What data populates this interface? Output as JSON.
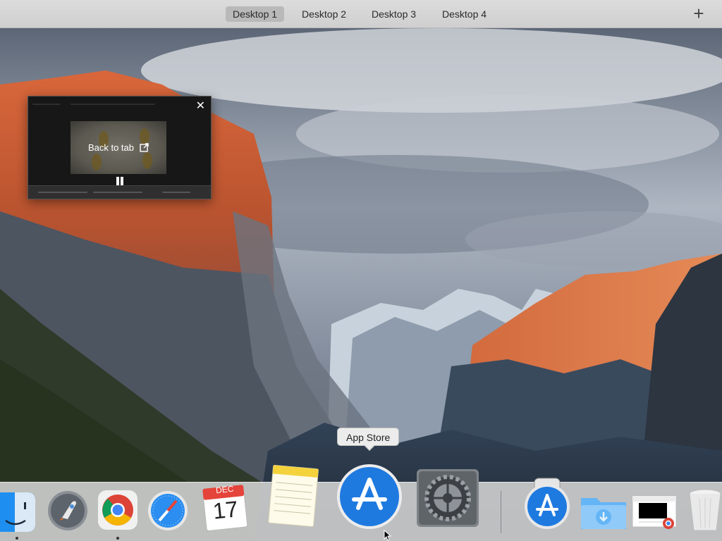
{
  "spaces_bar": {
    "tabs": [
      {
        "label": "Desktop 1",
        "active": true
      },
      {
        "label": "Desktop 2",
        "active": false
      },
      {
        "label": "Desktop 3",
        "active": false
      },
      {
        "label": "Desktop 4",
        "active": false
      }
    ],
    "add_label": "+"
  },
  "pip": {
    "back_to_tab_label": "Back to tab",
    "close_label": "✕",
    "back_icon": "open-in-new-icon",
    "state": "playing"
  },
  "dock": {
    "tooltip": "App Store",
    "apps": [
      {
        "name": "Finder",
        "running": true
      },
      {
        "name": "Launchpad",
        "running": false
      },
      {
        "name": "Google Chrome",
        "running": true
      },
      {
        "name": "Safari",
        "running": false
      },
      {
        "name": "Calendar",
        "running": false,
        "month": "DEC",
        "day": "17"
      },
      {
        "name": "Notes",
        "running": false
      },
      {
        "name": "App Store",
        "running": false
      },
      {
        "name": "System Preferences",
        "running": false
      }
    ],
    "others": [
      {
        "name": "App Store Download"
      },
      {
        "name": "Downloads"
      },
      {
        "name": "Chrome Window"
      },
      {
        "name": "Trash"
      }
    ]
  },
  "colors": {
    "accent_blue": "#1f7ae0",
    "spaces_bar": "#d6d6d6",
    "dock": "#d7d7d7"
  }
}
